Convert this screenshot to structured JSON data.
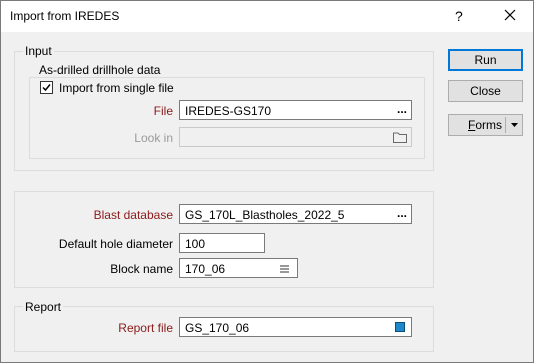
{
  "window": {
    "title": "Import from IREDES",
    "help_glyph": "?"
  },
  "input_group": {
    "label": "Input",
    "drillhole_group": {
      "label": "As-drilled drillhole data",
      "single_file_checkbox": {
        "label": "Import from single file",
        "checked": true
      },
      "file": {
        "label": "File",
        "value": "IREDES-GS170",
        "browse": "..."
      },
      "look_in": {
        "label": "Look in",
        "value": ""
      }
    }
  },
  "blast_group": {
    "blast_database": {
      "label": "Blast database",
      "value": "GS_170L_Blastholes_2022_5",
      "browse": "..."
    },
    "hole_diameter": {
      "label": "Default hole diameter",
      "value": "100"
    },
    "block_name": {
      "label": "Block name",
      "value": "170_06"
    }
  },
  "report_group": {
    "label": "Report",
    "report_file": {
      "label": "Report file",
      "value": "GS_170_06"
    }
  },
  "buttons": {
    "run": "Run",
    "close": "Close",
    "forms": "Forms"
  },
  "colors": {
    "required_label": "#8b1a1a",
    "default_button_border": "#0078d7",
    "report_icon": "#1e88c8"
  }
}
